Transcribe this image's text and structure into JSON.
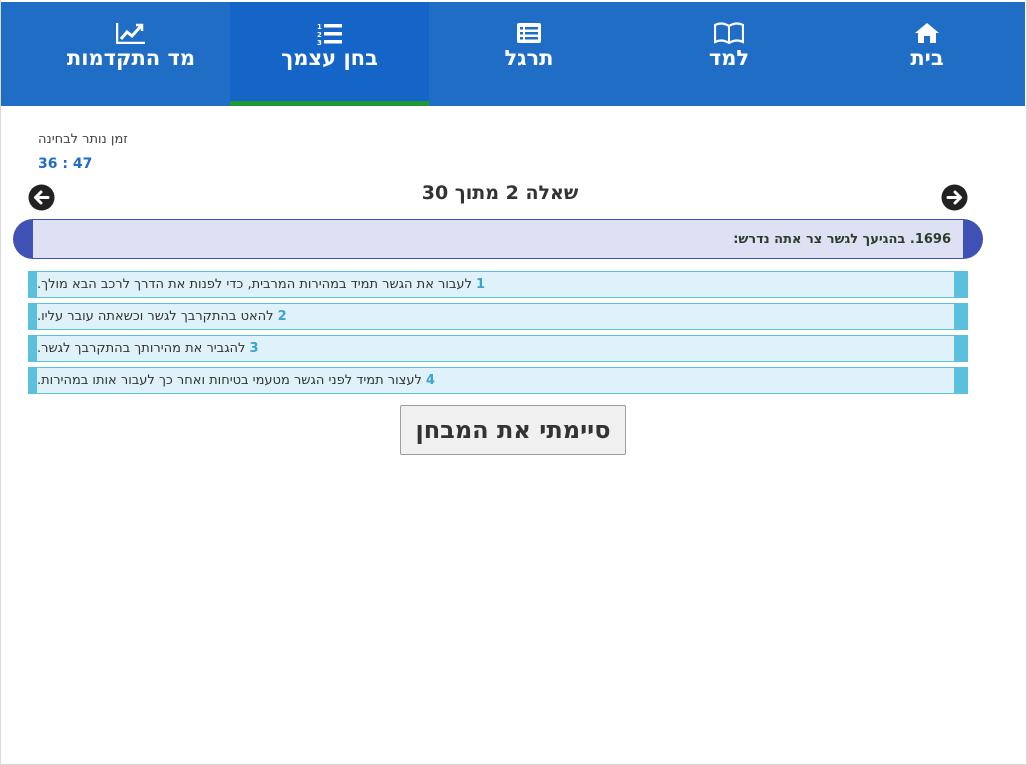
{
  "nav": {
    "tabs": [
      {
        "label": "בית",
        "icon": "home-icon"
      },
      {
        "label": "למד",
        "icon": "book-icon"
      },
      {
        "label": "תרגל",
        "icon": "list-card-icon"
      },
      {
        "label": "בחן עצמך",
        "icon": "numbered-list-icon",
        "active": true
      },
      {
        "label": "מד התקדמות",
        "icon": "chart-line-icon"
      }
    ]
  },
  "timer": {
    "label": "זמן נותר לבחינה",
    "value": "36 : 47"
  },
  "question": {
    "counter": "שאלה 2 מתוך 30",
    "text": "1696. בהגיעך לגשר צר אתה נדרש:"
  },
  "answers": [
    {
      "num": "1",
      "text": "לעבור את הגשר תמיד במהירות המרבית, כדי לפנות את הדרך לרכב הבא מולך."
    },
    {
      "num": "2",
      "text": "להאט בהתקרבך לגשר וכשאתה עובר עליו."
    },
    {
      "num": "3",
      "text": "להגביר את מהירותך בהתקרבך לגשר."
    },
    {
      "num": "4",
      "text": "לעצור תמיד לפני הגשר מטעמי בטיחות ואחר כך לעבור אותו במהירות."
    }
  ],
  "finish_button": "סיימתי את המבחן",
  "colors": {
    "nav_bg": "#1f6dc5",
    "active_tab_bar": "#1e9a34",
    "question_border": "#3f51b5",
    "answer_accent": "#5bc0de"
  }
}
